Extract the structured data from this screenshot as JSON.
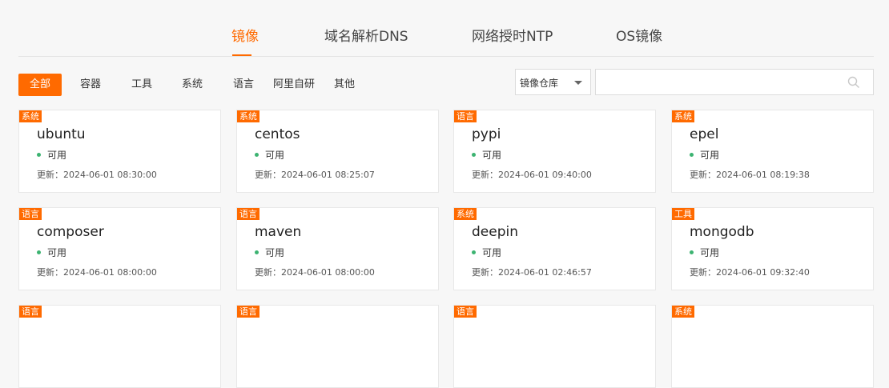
{
  "accent_color": "#ff6a00",
  "status_color": "#3cb371",
  "nav_tabs": [
    {
      "label": "镜像",
      "active": true
    },
    {
      "label": "域名解析DNS",
      "active": false
    },
    {
      "label": "网络授时NTP",
      "active": false
    },
    {
      "label": "OS镜像",
      "active": false
    }
  ],
  "filters": [
    {
      "label": "全部",
      "active": true
    },
    {
      "label": "容器",
      "active": false
    },
    {
      "label": "工具",
      "active": false
    },
    {
      "label": "系统",
      "active": false
    },
    {
      "label": "语言",
      "active": false
    },
    {
      "label": "阿里自研",
      "active": false
    },
    {
      "label": "其他",
      "active": false
    }
  ],
  "search": {
    "select_value": "镜像仓库",
    "input_value": "",
    "input_placeholder": "",
    "icon": "search-icon"
  },
  "cards": [
    {
      "tag": "系统",
      "name": "ubuntu",
      "status": "可用",
      "updated": "更新：2024-06-01 08:30:00"
    },
    {
      "tag": "系统",
      "name": "centos",
      "status": "可用",
      "updated": "更新：2024-06-01 08:25:07"
    },
    {
      "tag": "语言",
      "name": "pypi",
      "status": "可用",
      "updated": "更新：2024-06-01 09:40:00"
    },
    {
      "tag": "系统",
      "name": "epel",
      "status": "可用",
      "updated": "更新：2024-06-01 08:19:38"
    },
    {
      "tag": "语言",
      "name": "composer",
      "status": "可用",
      "updated": "更新：2024-06-01 08:00:00"
    },
    {
      "tag": "语言",
      "name": "maven",
      "status": "可用",
      "updated": "更新：2024-06-01 08:00:00"
    },
    {
      "tag": "系统",
      "name": "deepin",
      "status": "可用",
      "updated": "更新：2024-06-01 02:46:57"
    },
    {
      "tag": "工具",
      "name": "mongodb",
      "status": "可用",
      "updated": "更新：2024-06-01 09:32:40"
    },
    {
      "tag": "语言",
      "name": "",
      "status": "",
      "updated": ""
    },
    {
      "tag": "语言",
      "name": "",
      "status": "",
      "updated": ""
    },
    {
      "tag": "语言",
      "name": "",
      "status": "",
      "updated": ""
    },
    {
      "tag": "系统",
      "name": "",
      "status": "",
      "updated": ""
    }
  ]
}
